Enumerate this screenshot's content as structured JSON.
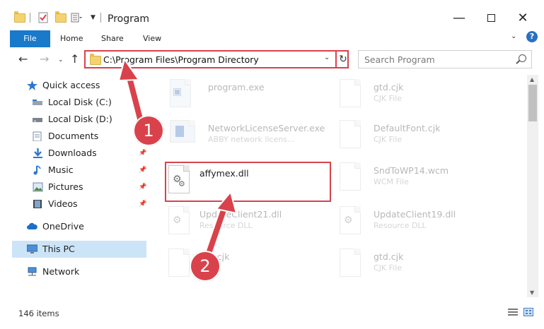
{
  "window": {
    "title": "Program"
  },
  "ribbon": {
    "tabs": [
      "File",
      "Home",
      "Share",
      "View"
    ]
  },
  "address": {
    "path": "C:\\Program Files\\Program Directory"
  },
  "search": {
    "placeholder": "Search Program"
  },
  "nav": {
    "items": [
      {
        "label": "Quick access",
        "icon": "star-icon"
      },
      {
        "label": "Local Disk (C:)",
        "icon": "drive-icon"
      },
      {
        "label": "Local Disk (D:)",
        "icon": "drive-icon"
      },
      {
        "label": "Documents",
        "icon": "documents-icon"
      },
      {
        "label": "Downloads",
        "icon": "download-icon",
        "pinned": true
      },
      {
        "label": "Music",
        "icon": "music-icon",
        "pinned": true
      },
      {
        "label": "Pictures",
        "icon": "pictures-icon",
        "pinned": true
      },
      {
        "label": "Videos",
        "icon": "videos-icon",
        "pinned": true
      },
      {
        "label": "OneDrive",
        "icon": "cloud-icon"
      },
      {
        "label": "This PC",
        "icon": "computer-icon",
        "selected": true
      },
      {
        "label": "Network",
        "icon": "network-icon"
      }
    ]
  },
  "files": [
    {
      "name": "program.exe",
      "type": ""
    },
    {
      "name": "gtd.cjk",
      "type": "CJK File"
    },
    {
      "name": "NetworkLicenseServer.exe",
      "type": "ABBY network licens..."
    },
    {
      "name": "DefaultFont.cjk",
      "type": "CJK File"
    },
    {
      "name": "affymex.dll",
      "type": ""
    },
    {
      "name": "SndToWP14.wcm",
      "type": "WCM File"
    },
    {
      "name": "UpdateClient21.dll",
      "type": "Resource DLL"
    },
    {
      "name": "UpdateClient19.dll",
      "type": "Resource DLL"
    },
    {
      "name": "gtd.cjk",
      "type": ""
    },
    {
      "name": "gtd.cjk",
      "type": "CJK File"
    }
  ],
  "status": {
    "item_count": "146 items"
  },
  "annotations": {
    "step1": "1",
    "step2": "2"
  },
  "colors": {
    "accent": "#1979ca",
    "highlight": "#d9424b",
    "selection": "#cce4f7"
  }
}
